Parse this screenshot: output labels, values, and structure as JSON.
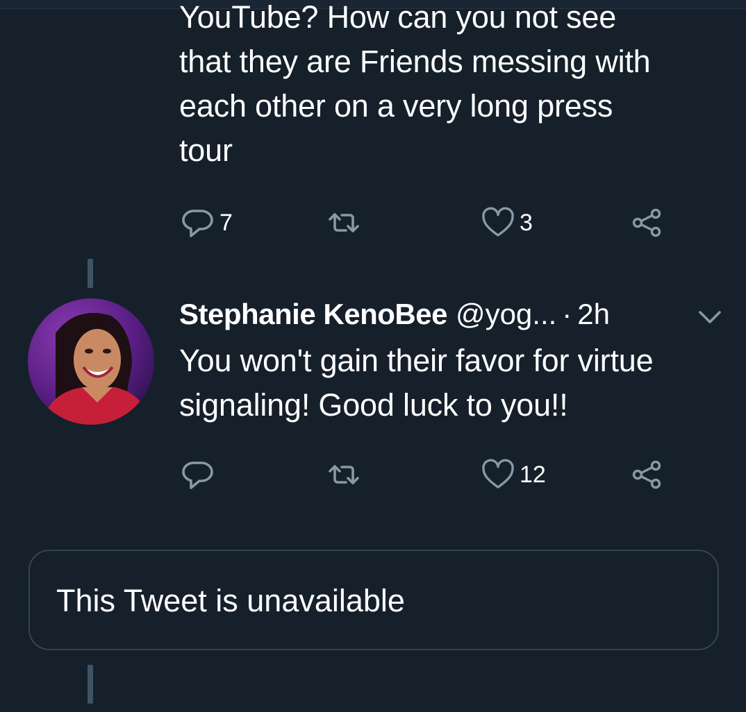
{
  "tweet1": {
    "text": "YouTube? How can you not see\nthat they are Friends messing with\neach other on a very long press\ntour",
    "replies": "7",
    "retweets": "",
    "likes": "3"
  },
  "tweet2": {
    "display_name": "Stephanie KenoBee",
    "handle": "@yog...",
    "separator": "·",
    "timestamp": "2h",
    "text": "You won't gain their favor for virtue signaling! Good luck to you!!",
    "replies": "",
    "retweets": "",
    "likes": "12"
  },
  "unavailable": {
    "text": "This Tweet is unavailable"
  },
  "icons": {
    "reply": "reply-icon",
    "retweet": "retweet-icon",
    "like": "heart-icon",
    "share": "share-icon",
    "more": "chevron-down-icon"
  },
  "colors": {
    "background": "#15202b",
    "icon": "#8899a6",
    "thread_line": "#3d5466",
    "card_border": "#38444d"
  }
}
